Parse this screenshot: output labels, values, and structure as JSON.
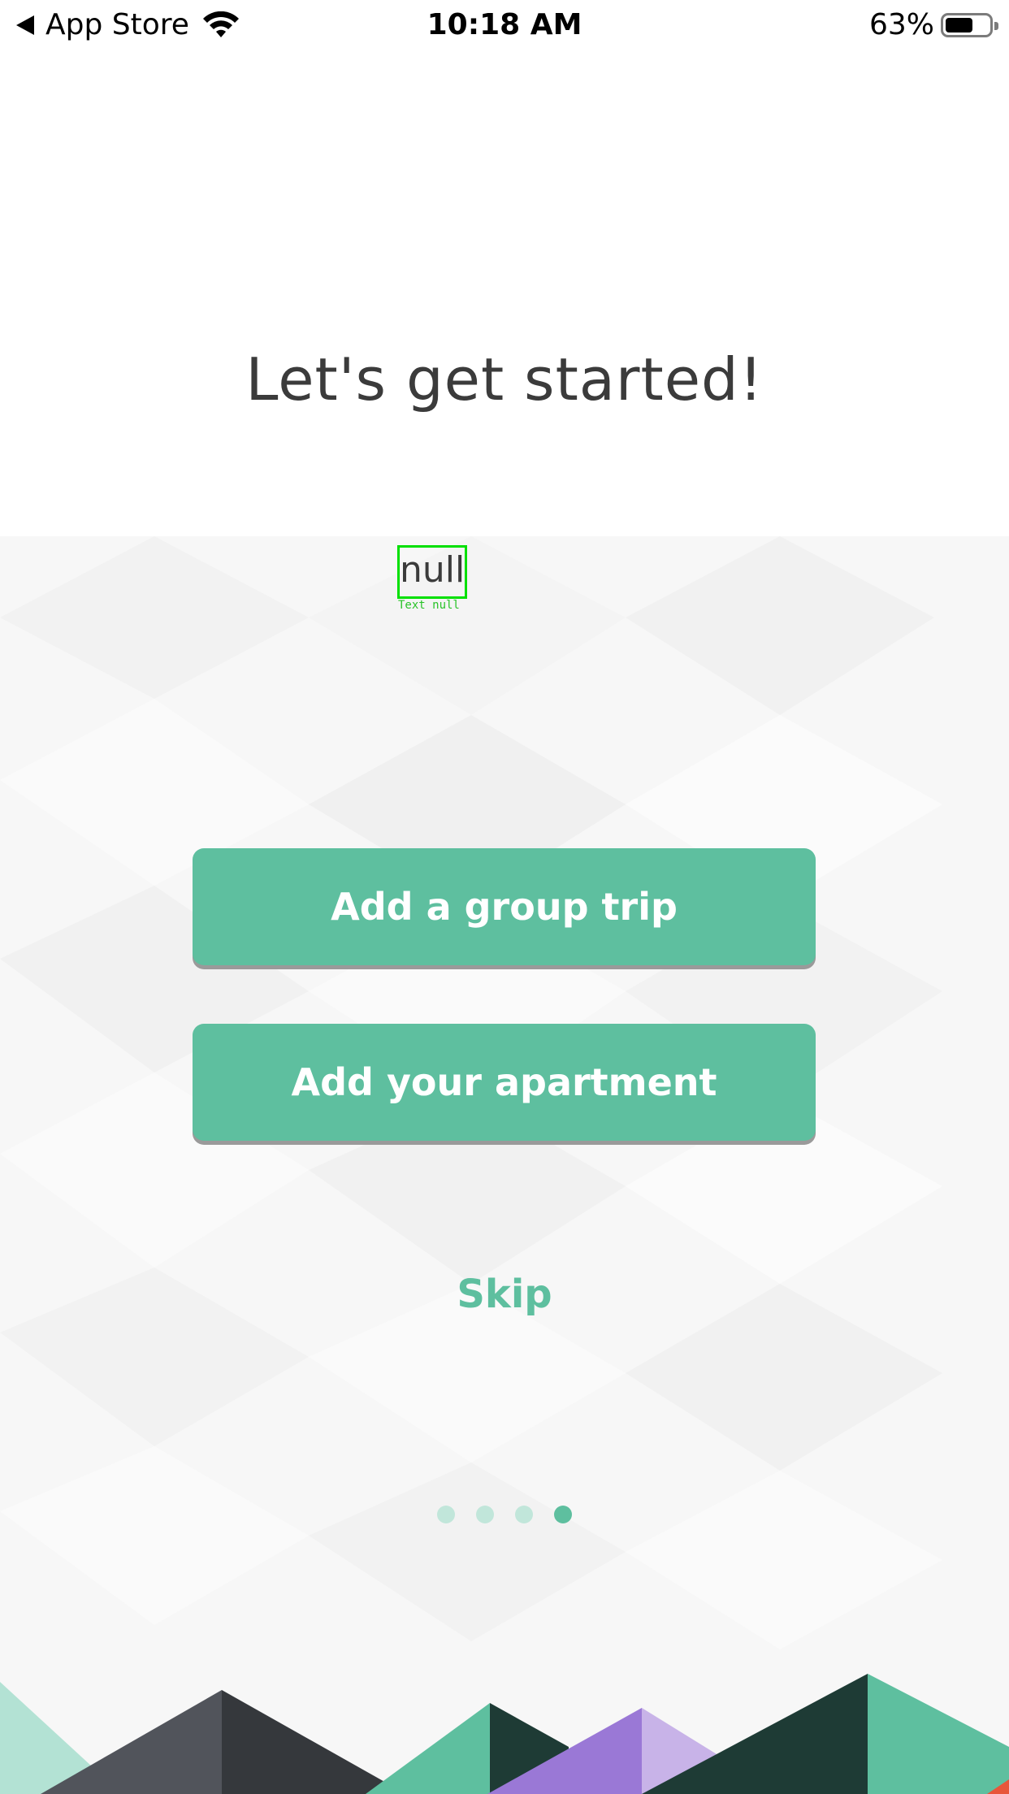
{
  "status_bar": {
    "back_app": "App Store",
    "time": "10:18 AM",
    "battery_percent": "63%",
    "battery_level": 0.63
  },
  "title": "Let's get started!",
  "debug_label": {
    "text": "null",
    "caption": "Text null"
  },
  "buttons": {
    "group_trip": "Add a group trip",
    "apartment": "Add your apartment",
    "skip": "Skip"
  },
  "pagination": {
    "total": 4,
    "active_index": 3
  },
  "colors": {
    "accent": "#5ebf9f",
    "title_text": "#3b3b3b",
    "dot_inactive": "#c1e6da",
    "debug_border": "#00e000"
  }
}
